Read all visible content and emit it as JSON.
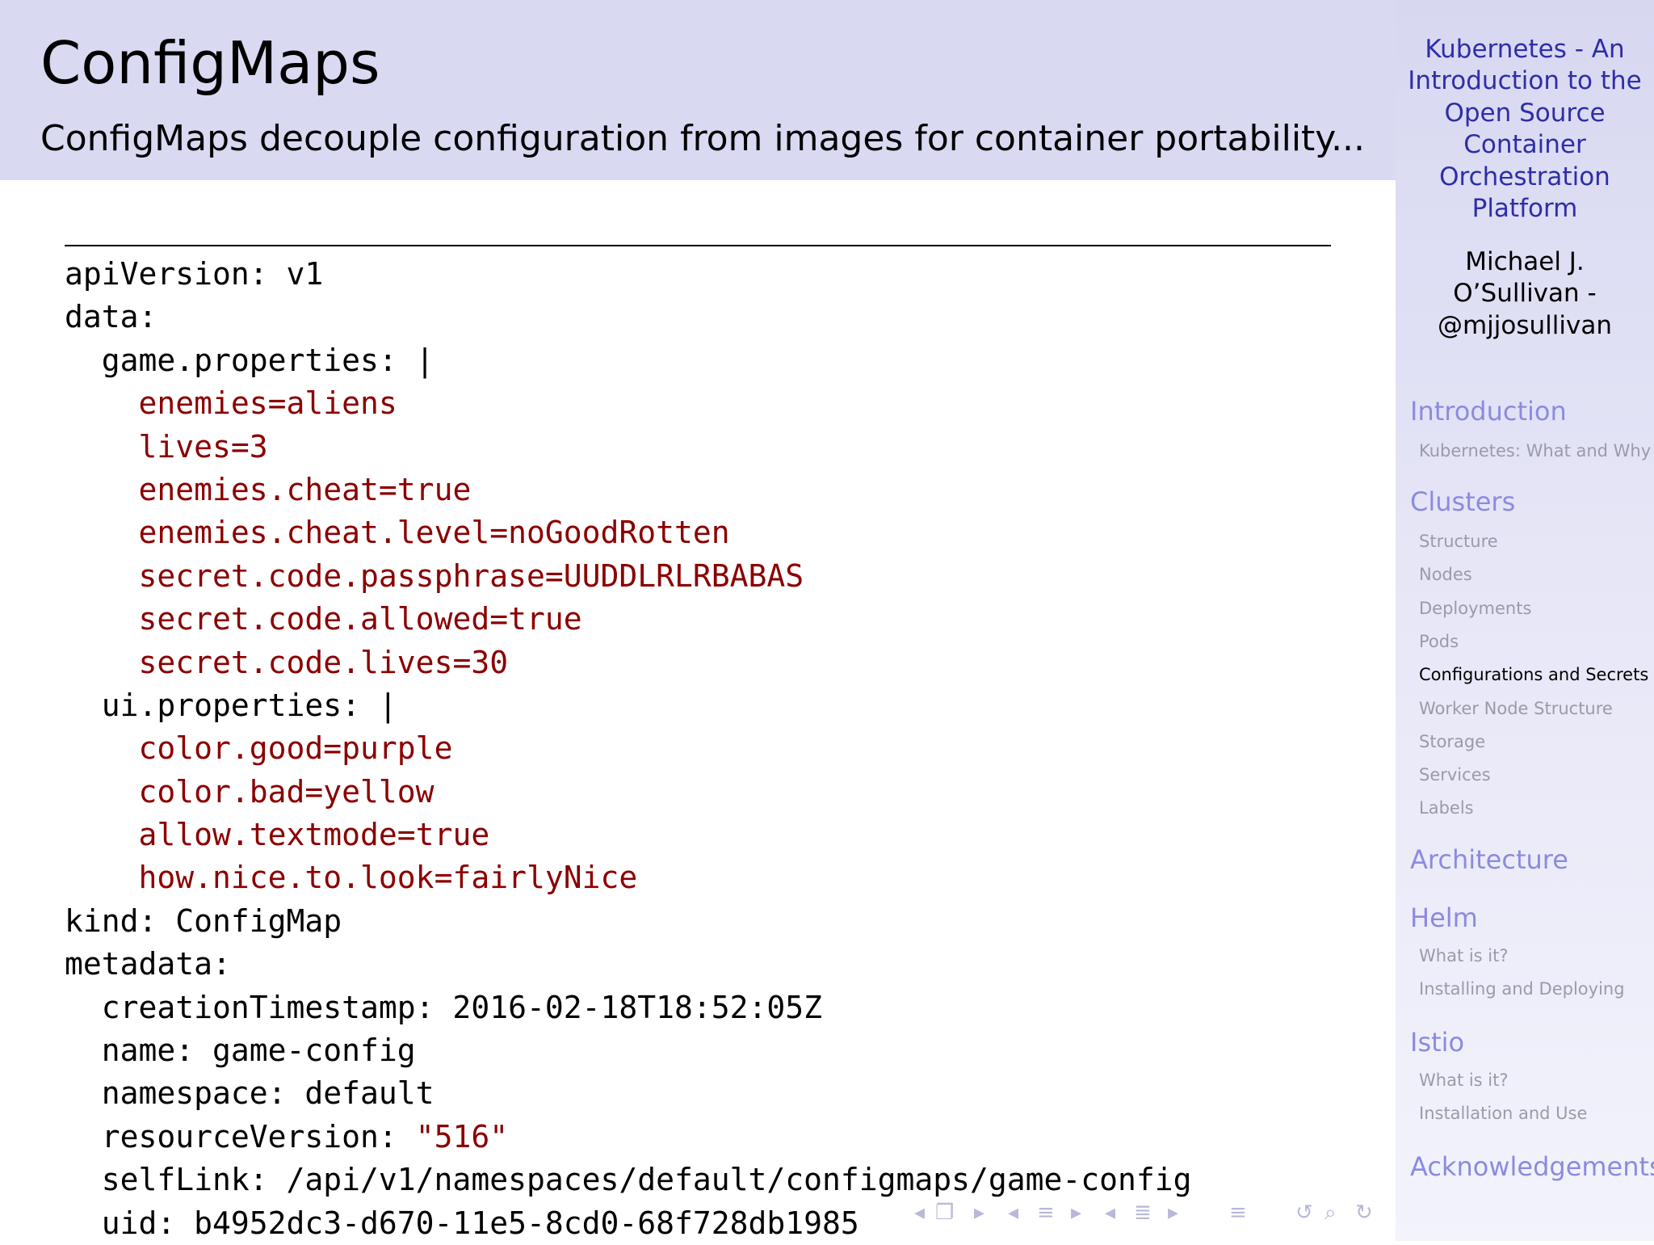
{
  "slide": {
    "title": "ConfigMaps",
    "subtitle": "ConfigMaps decouple configuration from images for container portability..."
  },
  "sidebar": {
    "title_lines": [
      "Kubernetes - An",
      "Introduction to the",
      "Open Source",
      "Container",
      "Orchestration",
      "Platform"
    ],
    "author_lines": [
      "Michael J.",
      "O’Sullivan -",
      "@mjjosullivan"
    ],
    "sections": [
      {
        "label": "Introduction",
        "items": [
          {
            "label": "Kubernetes: What and Why"
          }
        ]
      },
      {
        "label": "Clusters",
        "items": [
          {
            "label": "Structure"
          },
          {
            "label": "Nodes"
          },
          {
            "label": "Deployments"
          },
          {
            "label": "Pods"
          },
          {
            "label": "Configurations and Secrets",
            "active": true
          },
          {
            "label": "Worker Node Structure"
          },
          {
            "label": "Storage"
          },
          {
            "label": "Services"
          },
          {
            "label": "Labels"
          }
        ]
      },
      {
        "label": "Architecture",
        "items": []
      },
      {
        "label": "Helm",
        "items": [
          {
            "label": "What is it?"
          },
          {
            "label": "Installing and Deploying"
          }
        ]
      },
      {
        "label": "Istio",
        "items": [
          {
            "label": "What is it?"
          },
          {
            "label": "Installation and Use"
          }
        ]
      },
      {
        "label": "Acknowledgements",
        "items": []
      }
    ]
  },
  "code": {
    "lines": [
      [
        {
          "t": "apiVersion: v1"
        }
      ],
      [
        {
          "t": "data:"
        }
      ],
      [
        {
          "t": "  game.properties: |"
        }
      ],
      [
        {
          "t": "    "
        },
        {
          "t": "enemies=aliens",
          "c": "red"
        }
      ],
      [
        {
          "t": "    "
        },
        {
          "t": "lives=3",
          "c": "red"
        }
      ],
      [
        {
          "t": "    "
        },
        {
          "t": "enemies.cheat=true",
          "c": "red"
        }
      ],
      [
        {
          "t": "    "
        },
        {
          "t": "enemies.cheat.level=noGoodRotten",
          "c": "red"
        }
      ],
      [
        {
          "t": "    "
        },
        {
          "t": "secret.code.passphrase=UUDDLRLRBABAS",
          "c": "red"
        }
      ],
      [
        {
          "t": "    "
        },
        {
          "t": "secret.code.allowed=true",
          "c": "red"
        }
      ],
      [
        {
          "t": "    "
        },
        {
          "t": "secret.code.lives=30",
          "c": "red"
        }
      ],
      [
        {
          "t": "  ui.properties: |"
        }
      ],
      [
        {
          "t": "    "
        },
        {
          "t": "color.good=purple",
          "c": "red"
        }
      ],
      [
        {
          "t": "    "
        },
        {
          "t": "color.bad=yellow",
          "c": "red"
        }
      ],
      [
        {
          "t": "    "
        },
        {
          "t": "allow.textmode=true",
          "c": "red"
        }
      ],
      [
        {
          "t": "    "
        },
        {
          "t": "how.nice.to.look=fairlyNice",
          "c": "red"
        }
      ],
      [
        {
          "t": "kind: ConfigMap"
        }
      ],
      [
        {
          "t": "metadata:"
        }
      ],
      [
        {
          "t": "  creationTimestamp: 2016-02-18T18:52:05Z"
        }
      ],
      [
        {
          "t": "  name: game-config"
        }
      ],
      [
        {
          "t": "  namespace: default"
        }
      ],
      [
        {
          "t": "  resourceVersion: "
        },
        {
          "t": "\"516\"",
          "c": "red"
        }
      ],
      [
        {
          "t": "  selfLink: /api/v1/namespaces/default/configmaps/game-config"
        }
      ],
      [
        {
          "t": "  uid: b4952dc3-d670-11e5-8cd0-68f728db1985"
        }
      ]
    ]
  },
  "nav_controls": [
    {
      "name": "nav-prev-slide-icon",
      "glyph": "◂"
    },
    {
      "name": "nav-slide-icon",
      "glyph": "❐"
    },
    {
      "name": "nav-next-slide-icon",
      "glyph": "▸"
    },
    {
      "name": "nav-prev-frame-icon",
      "glyph": "◂"
    },
    {
      "name": "nav-frame-icon",
      "glyph": "≡"
    },
    {
      "name": "nav-next-frame-icon",
      "glyph": "▸"
    },
    {
      "name": "nav-prev-subsection-icon",
      "glyph": "◂"
    },
    {
      "name": "nav-subsection-icon",
      "glyph": "≣"
    },
    {
      "name": "nav-next-subsection-icon",
      "glyph": "▸"
    },
    {
      "name": "nav-section-icon",
      "glyph": "≡"
    },
    {
      "name": "nav-back-icon",
      "glyph": "↺"
    },
    {
      "name": "nav-search-icon",
      "glyph": "⌕"
    },
    {
      "name": "nav-forward-icon",
      "glyph": "↻"
    }
  ]
}
